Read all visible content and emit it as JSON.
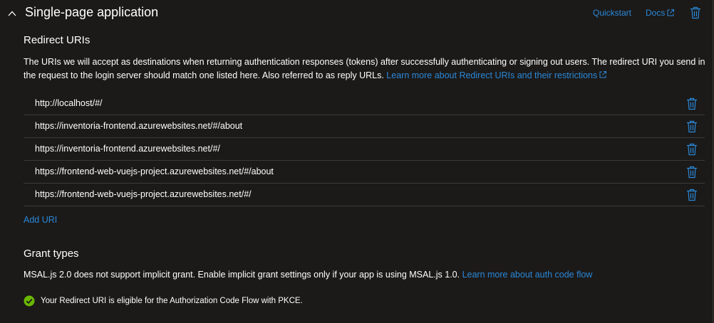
{
  "header": {
    "title": "Single-page application",
    "quickstart_label": "Quickstart",
    "docs_label": "Docs"
  },
  "redirect": {
    "heading": "Redirect URIs",
    "description": "The URIs we will accept as destinations when returning authentication responses (tokens) after successfully authenticating or signing out users. The redirect URI you send in the request to the login server should match one listed here. Also referred to as reply URLs. ",
    "learn_more": "Learn more about Redirect URIs and their restrictions",
    "uris": [
      "http://localhost/#/",
      "https://inventoria-frontend.azurewebsites.net/#/about",
      "https://inventoria-frontend.azurewebsites.net/#/",
      "https://frontend-web-vuejs-project.azurewebsites.net/#/about",
      "https://frontend-web-vuejs-project.azurewebsites.net/#/"
    ],
    "add_uri_label": "Add URI"
  },
  "grant": {
    "heading": "Grant types",
    "description": "MSAL.js 2.0 does not support implicit grant. Enable implicit grant settings only if your app is using MSAL.js 1.0. ",
    "learn_more": "Learn more about auth code flow",
    "status": "Your Redirect URI is eligible for the Authorization Code Flow with PKCE."
  },
  "icons": {
    "collapse": "chevron-up-icon",
    "external": "external-link-icon",
    "delete": "trash-icon",
    "success": "check-circle-icon"
  },
  "colors": {
    "background": "#1b1a19",
    "link": "#2b88d8",
    "success": "#6bb700",
    "divider": "#3b3a39"
  }
}
